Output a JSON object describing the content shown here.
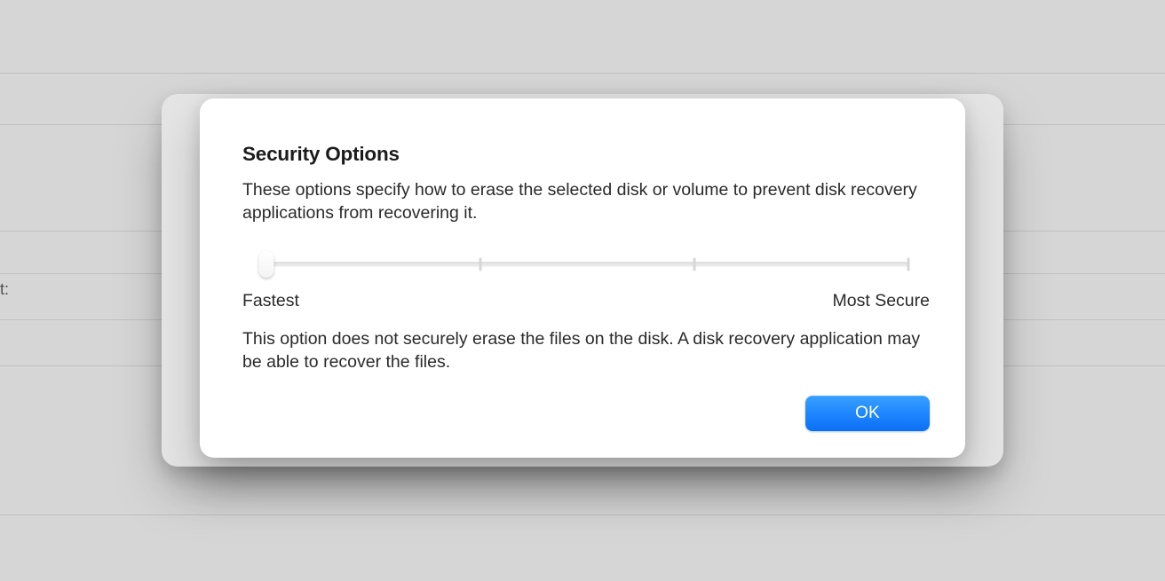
{
  "background": {
    "partial_label": "t:"
  },
  "dialog": {
    "title": "Security Options",
    "description": "These options specify how to erase the selected disk or volume to prevent disk recovery applications from recovering it.",
    "slider": {
      "min_label": "Fastest",
      "max_label": "Most Secure",
      "steps": 4,
      "value_index": 0
    },
    "current_option_description": "This option does not securely erase the files on the disk. A disk recovery application may be able to recover the files.",
    "ok_label": "OK"
  },
  "colors": {
    "accent": "#1e84ff"
  }
}
